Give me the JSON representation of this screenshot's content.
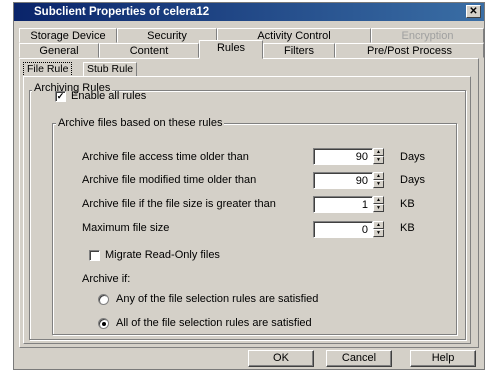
{
  "window": {
    "title": "Subclient Properties of celera12",
    "close_glyph": "✕"
  },
  "tabs_row1": [
    {
      "label": "Storage Device",
      "disabled": false
    },
    {
      "label": "Security",
      "disabled": false
    },
    {
      "label": "Activity Control",
      "disabled": false
    },
    {
      "label": "Encryption",
      "disabled": true
    }
  ],
  "tabs_row2": [
    {
      "label": "General"
    },
    {
      "label": "Content"
    },
    {
      "label": "Rules",
      "active": true
    },
    {
      "label": "Filters"
    },
    {
      "label": "Pre/Post Process"
    }
  ],
  "subtabs": [
    {
      "label": "File Rule",
      "active": true
    },
    {
      "label": "Stub Rule",
      "active": false
    }
  ],
  "archiving_rules": {
    "group_title": "Archiving Rules",
    "enable_all": {
      "label": "Enable all rules",
      "checked": true
    }
  },
  "archive_based": {
    "group_title": "Archive files based on these rules",
    "rules": [
      {
        "label": "Archive file access time older than",
        "value": "90",
        "unit": "Days"
      },
      {
        "label": "Archive file modified time older than",
        "value": "90",
        "unit": "Days"
      },
      {
        "label": "Archive file if the file size is greater than",
        "value": "1",
        "unit": "KB"
      },
      {
        "label": "Maximum file size",
        "value": "0",
        "unit": "KB"
      }
    ],
    "migrate_readonly": {
      "label": "Migrate Read-Only files",
      "checked": false
    },
    "archive_if": {
      "label": "Archive if:",
      "options": [
        {
          "label": "Any of the file selection rules are satisfied",
          "selected": false
        },
        {
          "label": "All of the file selection rules are satisfied",
          "selected": true
        }
      ]
    }
  },
  "buttons": {
    "ok": "OK",
    "cancel": "Cancel",
    "help": "Help"
  },
  "colors": {
    "face": "#d4d0c8",
    "title_bar": "#0a246a",
    "disabled_text": "#a0a0a0"
  },
  "icons": {
    "close": "close-icon",
    "checkmark": "checkmark-icon",
    "spin_up": "spin-up-arrow-icon",
    "spin_down": "spin-down-arrow-icon"
  }
}
